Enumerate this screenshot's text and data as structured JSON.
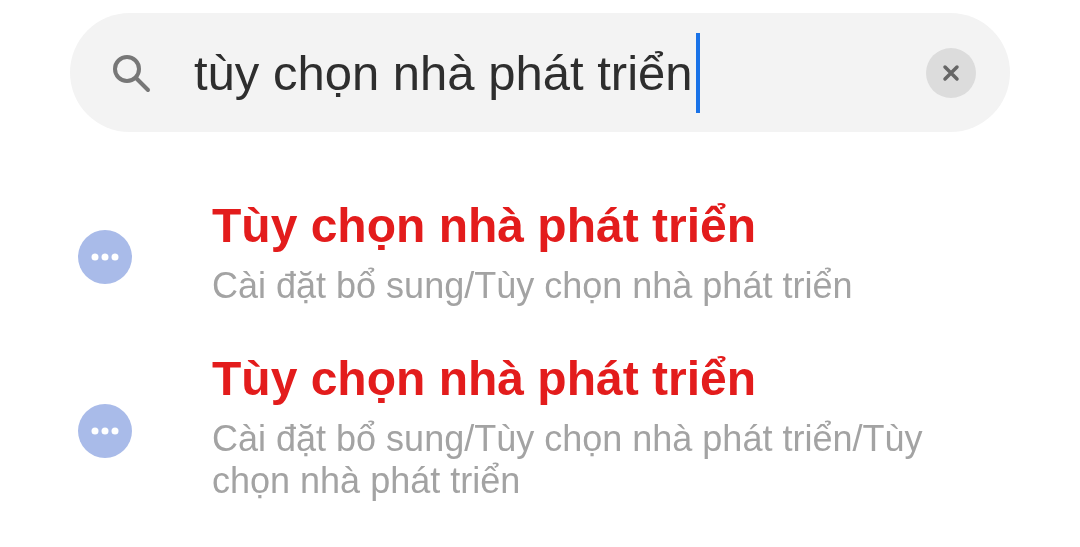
{
  "search": {
    "value": "tùy chọn nhà phát triển"
  },
  "results": [
    {
      "title": "Tùy chọn nhà phát triển",
      "path": "Cài đặt bổ sung/Tùy chọn nhà phát triển"
    },
    {
      "title": "Tùy chọn nhà phát triển",
      "path": "Cài đặt bổ sung/Tùy chọn nhà phát triển/Tùy chọn nhà phát triển"
    }
  ]
}
